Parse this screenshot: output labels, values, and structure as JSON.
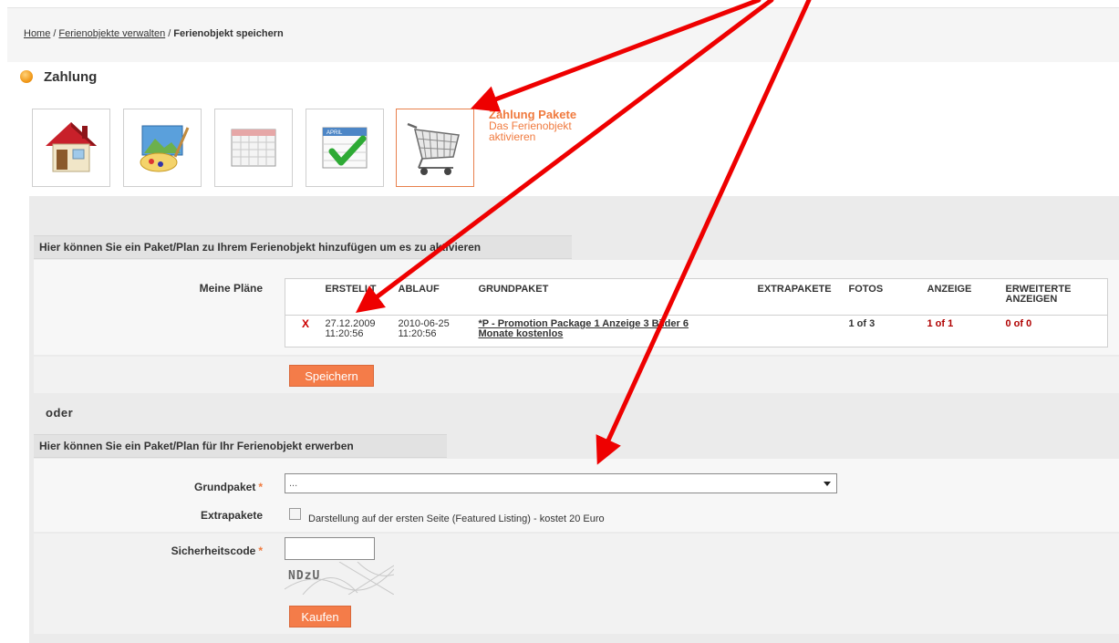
{
  "breadcrumb": {
    "home": "Home",
    "separator": "/",
    "manage": "Ferienobjekte verwalten",
    "current": "Ferienobjekt speichern"
  },
  "section": {
    "title": "Zahlung"
  },
  "steps": {
    "items": [
      {
        "icon": "house-icon"
      },
      {
        "icon": "paint-palette-icon"
      },
      {
        "icon": "calendar-icon"
      },
      {
        "icon": "calendar-check-icon",
        "label": "APRIL"
      },
      {
        "icon": "shopping-cart-icon"
      }
    ],
    "active_title": "Zahlung Pakete",
    "active_desc_1": "Das Ferienobjekt",
    "active_desc_2": "aktivieren"
  },
  "plans_section": {
    "header": "Hier können Sie ein Paket/Plan zu Ihrem Ferienobjekt hinzufügen um es zu aktivieren",
    "label": "Meine Pläne",
    "columns": {
      "created": "ERSTELLT",
      "expires": "ABLAUF",
      "base": "GRUNDPAKET",
      "extras": "EXTRAPAKETE",
      "photos": "FOTOS",
      "ad": "ANZEIGE",
      "extended_1": "ERWEITERTE",
      "extended_2": "ANZEIGEN"
    },
    "row": {
      "delete": "X",
      "created_date": "27.12.2009",
      "created_time": "11:20:56",
      "expires_date": "2010-06-25",
      "expires_time": "11:20:56",
      "package_1": "*P - Promotion Package 1 Anzeige 3 Bilder 6",
      "package_2": "Monate kostenlos",
      "extras": "",
      "photos": "1 of 3",
      "ad": "1 of 1",
      "extended": "0 of 0"
    },
    "save_button": "Speichern"
  },
  "or_text": "oder",
  "buy_section": {
    "header": "Hier können Sie ein Paket/Plan für Ihr Ferienobjekt erwerben",
    "base_label": "Grundpaket",
    "required_mark": "*",
    "base_selected": "...",
    "extras_label": "Extrapakete",
    "featured_option": "Darstellung auf der ersten Seite (Featured Listing) - kostet 20 Euro",
    "security_label": "Sicherheitscode",
    "captcha_text": "NDzU",
    "buy_button": "Kaufen"
  },
  "colors": {
    "accent": "#f47c49",
    "link_orange": "#f07a3e",
    "arrow": "#ee0000",
    "value_red": "#b00000"
  }
}
